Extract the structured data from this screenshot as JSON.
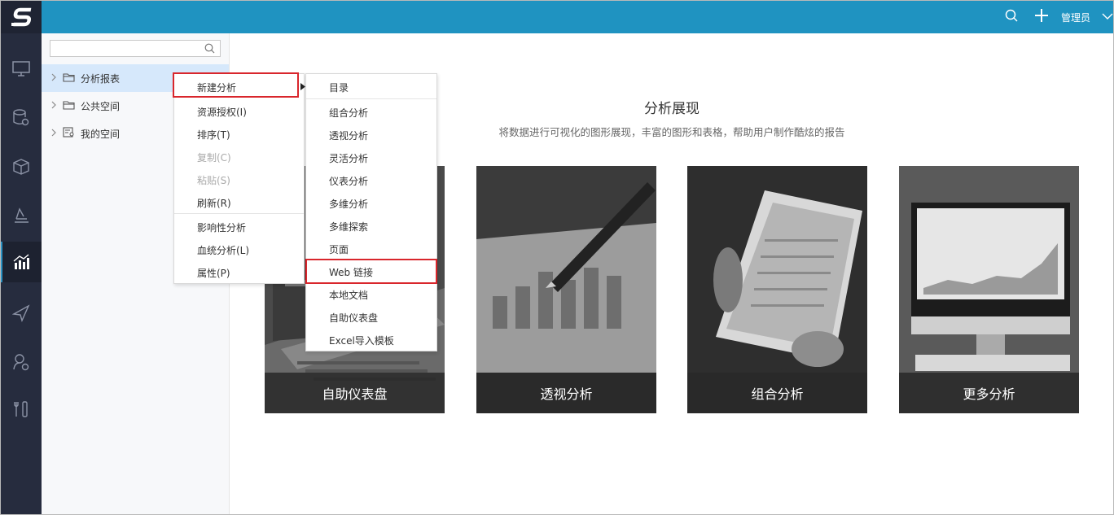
{
  "topbar": {
    "user_label": "管理员"
  },
  "search": {
    "placeholder": ""
  },
  "tree": {
    "items": [
      {
        "label": "分析报表"
      },
      {
        "label": "公共空间"
      },
      {
        "label": "我的空间"
      }
    ]
  },
  "hero": {
    "title": "分析展现",
    "subtitle": "将数据进行可视化的图形展现，丰富的图形和表格，帮助用户制作酷炫的报告"
  },
  "cards": [
    {
      "label": "自助仪表盘"
    },
    {
      "label": "透视分析"
    },
    {
      "label": "组合分析"
    },
    {
      "label": "更多分析"
    }
  ],
  "context_menu": {
    "items": [
      {
        "label": "新建分析",
        "enabled": true
      },
      {
        "label": "资源授权(I)",
        "enabled": true
      },
      {
        "label": "排序(T)",
        "enabled": true
      },
      {
        "label": "复制(C)",
        "enabled": false
      },
      {
        "label": "粘贴(S)",
        "enabled": false
      },
      {
        "label": "刷新(R)",
        "enabled": true
      },
      {
        "label": "影响性分析",
        "enabled": true
      },
      {
        "label": "血统分析(L)",
        "enabled": true
      },
      {
        "label": "属性(P)",
        "enabled": true
      }
    ]
  },
  "submenu": {
    "items": [
      {
        "label": "目录"
      },
      {
        "label": "组合分析"
      },
      {
        "label": "透视分析"
      },
      {
        "label": "灵活分析"
      },
      {
        "label": "仪表分析"
      },
      {
        "label": "多维分析"
      },
      {
        "label": "多维探索"
      },
      {
        "label": "页面"
      },
      {
        "label": "Web 链接"
      },
      {
        "label": "本地文档"
      },
      {
        "label": "自助仪表盘"
      },
      {
        "label": "Excel导入模板"
      }
    ]
  },
  "colors": {
    "topbar": "#1f93c1",
    "rail": "#262c3e",
    "highlight": "#d9262c",
    "selected_row": "#d6e8fb"
  }
}
